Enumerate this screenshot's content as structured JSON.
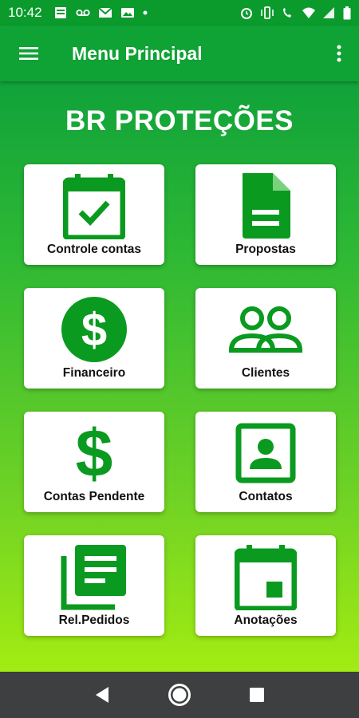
{
  "status_bar": {
    "time": "10:42",
    "left_icons": [
      "notes-icon",
      "voicemail-icon",
      "gmail-icon",
      "photo-message-icon",
      "dot-icon"
    ],
    "right_icons": [
      "alarm-icon",
      "vibrate-icon",
      "wifi-calling-icon",
      "wifi-icon",
      "signal-4g-icon",
      "battery-icon"
    ]
  },
  "app_bar": {
    "title": "Menu Principal",
    "menu_icon": "hamburger-menu-icon",
    "more_icon": "more-vert-icon"
  },
  "brand": "BR PROTEÇÕES",
  "colors": {
    "primary": "#0fa234",
    "icon_green": "#0a9a1f",
    "gradient_top": "#10a23a",
    "gradient_bottom": "#a2ec12",
    "nav_bar": "#3d3f40"
  },
  "tiles": [
    {
      "label": "Controle contas",
      "icon": "calendar-check-icon"
    },
    {
      "label": "Propostas",
      "icon": "document-icon"
    },
    {
      "label": "Financeiro",
      "icon": "dollar-circle-icon"
    },
    {
      "label": "Clientes",
      "icon": "people-icon"
    },
    {
      "label": "Contas Pendente",
      "icon": "dollar-icon"
    },
    {
      "label": "Contatos",
      "icon": "contact-portrait-icon"
    },
    {
      "label": "Rel.Pedidos",
      "icon": "library-books-icon"
    },
    {
      "label": "Anotações",
      "icon": "calendar-event-icon"
    }
  ],
  "nav_bar": {
    "back_icon": "back-triangle-icon",
    "home_icon": "home-circle-icon",
    "recents_icon": "recents-square-icon"
  }
}
